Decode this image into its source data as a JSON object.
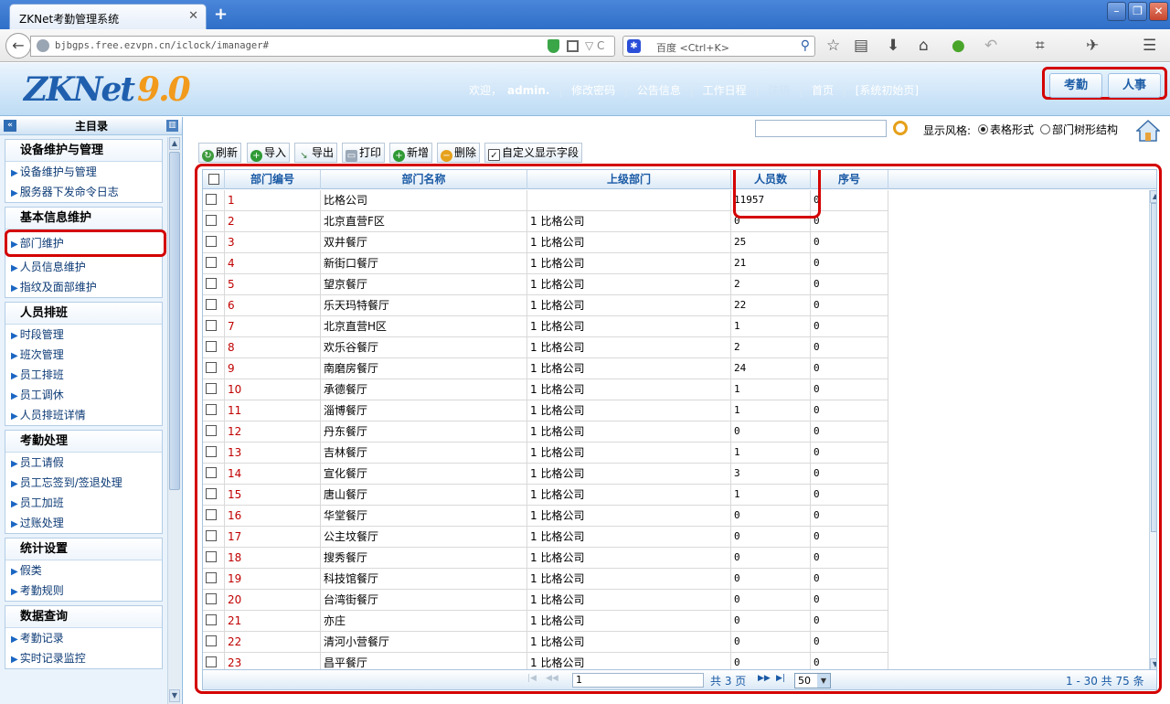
{
  "browser": {
    "tab_title": "ZKNet考勤管理系统",
    "url": "bjbgps.free.ezvpn.cn/iclock/imanager#",
    "search_engine": "百度",
    "search_placeholder": "<Ctrl+K>"
  },
  "header": {
    "logo_text": "ZKNet",
    "logo_version": "9.0",
    "welcome": "欢迎，",
    "user": "admin.",
    "links": [
      "修改密码",
      "公告信息",
      "工作日程",
      "注销",
      "首页",
      "[系统初始页]"
    ],
    "module_tabs": [
      "考勤",
      "人事"
    ]
  },
  "sidebar": {
    "title": "主目录",
    "groups": [
      {
        "title": "设备维护与管理",
        "items": [
          "设备维护与管理",
          "服务器下发命令日志"
        ]
      },
      {
        "title": "基本信息维护",
        "items": [
          "部门维护",
          "人员信息维护",
          "指纹及面部维护"
        ]
      },
      {
        "title": "人员排班",
        "items": [
          "时段管理",
          "班次管理",
          "员工排班",
          "员工调休",
          "人员排班详情"
        ]
      },
      {
        "title": "考勤处理",
        "items": [
          "员工请假",
          "员工忘签到/签退处理",
          "员工加班",
          "过账处理"
        ]
      },
      {
        "title": "统计设置",
        "items": [
          "假类",
          "考勤规则"
        ]
      },
      {
        "title": "数据查询",
        "items": [
          "考勤记录",
          "实时记录监控"
        ]
      }
    ]
  },
  "view": {
    "style_label": "显示风格:",
    "style_table": "表格形式",
    "style_tree": "部门树形结构"
  },
  "toolbar": {
    "refresh": "刷新",
    "import": "导入",
    "export": "导出",
    "print": "打印",
    "add": "新增",
    "delete": "删除",
    "custom_fields": "自定义显示字段"
  },
  "grid": {
    "columns": [
      "部门编号",
      "部门名称",
      "上级部门",
      "人员数",
      "序号"
    ],
    "rows": [
      {
        "id": "1",
        "name": "比格公司",
        "parent": "",
        "count": "11957",
        "seq": "0"
      },
      {
        "id": "2",
        "name": "北京直营F区",
        "parent": "1 比格公司",
        "count": "0",
        "seq": "0"
      },
      {
        "id": "3",
        "name": "双井餐厅",
        "parent": "1 比格公司",
        "count": "25",
        "seq": "0"
      },
      {
        "id": "4",
        "name": "新街口餐厅",
        "parent": "1 比格公司",
        "count": "21",
        "seq": "0"
      },
      {
        "id": "5",
        "name": "望京餐厅",
        "parent": "1 比格公司",
        "count": "2",
        "seq": "0"
      },
      {
        "id": "6",
        "name": "乐天玛特餐厅",
        "parent": "1 比格公司",
        "count": "22",
        "seq": "0"
      },
      {
        "id": "7",
        "name": "北京直营H区",
        "parent": "1 比格公司",
        "count": "1",
        "seq": "0"
      },
      {
        "id": "8",
        "name": "欢乐谷餐厅",
        "parent": "1 比格公司",
        "count": "2",
        "seq": "0"
      },
      {
        "id": "9",
        "name": "南磨房餐厅",
        "parent": "1 比格公司",
        "count": "24",
        "seq": "0"
      },
      {
        "id": "10",
        "name": "承德餐厅",
        "parent": "1 比格公司",
        "count": "1",
        "seq": "0"
      },
      {
        "id": "11",
        "name": "淄博餐厅",
        "parent": "1 比格公司",
        "count": "1",
        "seq": "0"
      },
      {
        "id": "12",
        "name": "丹东餐厅",
        "parent": "1 比格公司",
        "count": "0",
        "seq": "0"
      },
      {
        "id": "13",
        "name": "吉林餐厅",
        "parent": "1 比格公司",
        "count": "1",
        "seq": "0"
      },
      {
        "id": "14",
        "name": "宣化餐厅",
        "parent": "1 比格公司",
        "count": "3",
        "seq": "0"
      },
      {
        "id": "15",
        "name": "唐山餐厅",
        "parent": "1 比格公司",
        "count": "1",
        "seq": "0"
      },
      {
        "id": "16",
        "name": "华堂餐厅",
        "parent": "1 比格公司",
        "count": "0",
        "seq": "0"
      },
      {
        "id": "17",
        "name": "公主坟餐厅",
        "parent": "1 比格公司",
        "count": "0",
        "seq": "0"
      },
      {
        "id": "18",
        "name": "搜秀餐厅",
        "parent": "1 比格公司",
        "count": "0",
        "seq": "0"
      },
      {
        "id": "19",
        "name": "科技馆餐厅",
        "parent": "1 比格公司",
        "count": "0",
        "seq": "0"
      },
      {
        "id": "20",
        "name": "台湾街餐厅",
        "parent": "1 比格公司",
        "count": "0",
        "seq": "0"
      },
      {
        "id": "21",
        "name": "亦庄",
        "parent": "1 比格公司",
        "count": "0",
        "seq": "0"
      },
      {
        "id": "22",
        "name": "清河小营餐厅",
        "parent": "1 比格公司",
        "count": "0",
        "seq": "0"
      },
      {
        "id": "23",
        "name": "昌平餐厅",
        "parent": "1 比格公司",
        "count": "0",
        "seq": "0"
      }
    ]
  },
  "pager": {
    "page": "1",
    "total_pages": "共 3 页",
    "page_size": "50",
    "range": "1 - 30  共 75 条"
  },
  "colors": {
    "highlight": "#d40000",
    "id_text": "#c00000",
    "header_blue": "#1a5aa5"
  }
}
